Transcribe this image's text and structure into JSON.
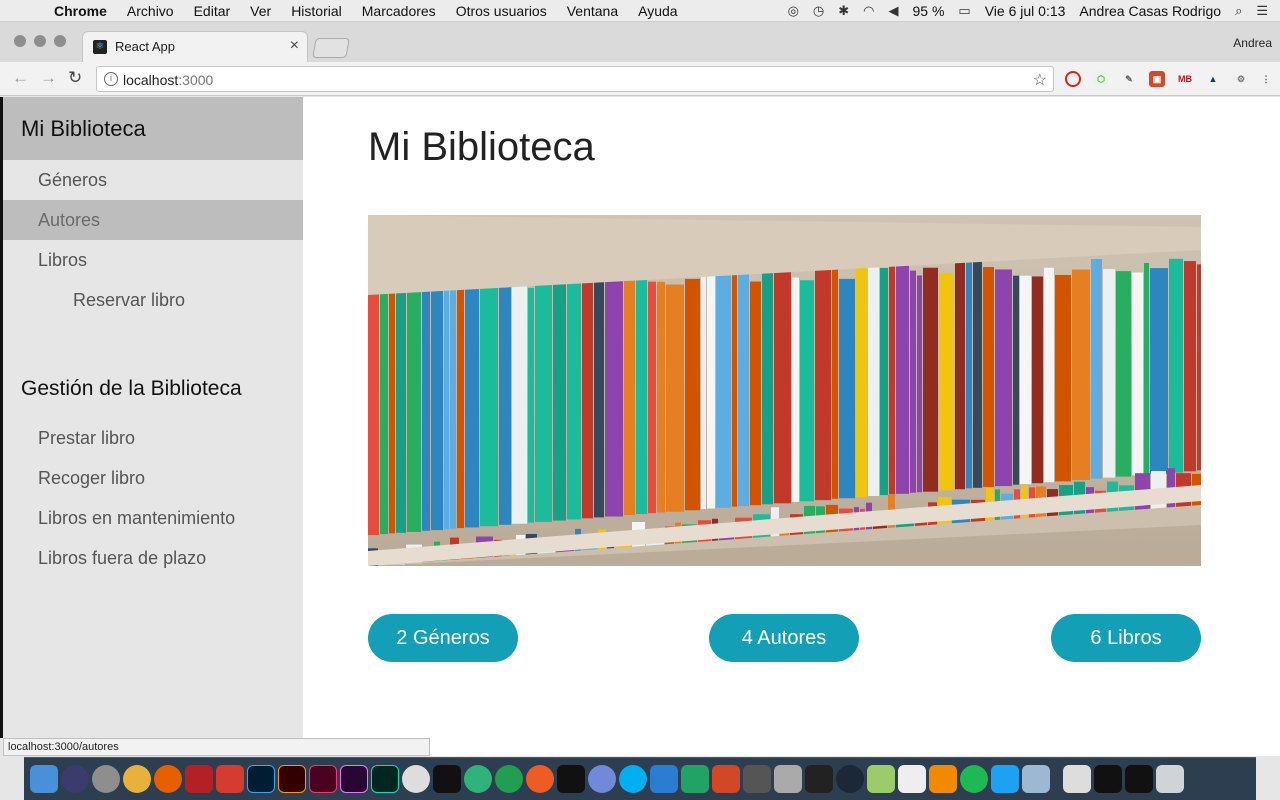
{
  "menubar": {
    "app": "Chrome",
    "items": [
      "Archivo",
      "Editar",
      "Ver",
      "Historial",
      "Marcadores",
      "Otros usuarios",
      "Ventana",
      "Ayuda"
    ],
    "battery": "95 %",
    "clock": "Vie 6 jul  0:13",
    "user": "Andrea Casas Rodrigo"
  },
  "browser": {
    "tab_title": "React App",
    "profile": "Andrea",
    "url_host": "localhost",
    "url_port": ":3000",
    "status_url": "localhost:3000/autores"
  },
  "sidebar": {
    "title": "Mi Biblioteca",
    "items": [
      {
        "label": "Géneros"
      },
      {
        "label": "Autores"
      },
      {
        "label": "Libros"
      },
      {
        "label": "Reservar libro"
      }
    ],
    "section_title": "Gestión de la Biblioteca",
    "section_items": [
      {
        "label": "Prestar libro"
      },
      {
        "label": "Recoger libro"
      },
      {
        "label": "Libros en mantenimiento"
      },
      {
        "label": "Libros fuera de plazo"
      }
    ]
  },
  "main": {
    "title": "Mi Biblioteca",
    "buttons": [
      {
        "label": "2 Géneros"
      },
      {
        "label": "4 Autores"
      },
      {
        "label": "6 Libros"
      }
    ]
  },
  "colors": {
    "accent": "#139fb5",
    "sidebar_active": "#bdbdbd"
  }
}
